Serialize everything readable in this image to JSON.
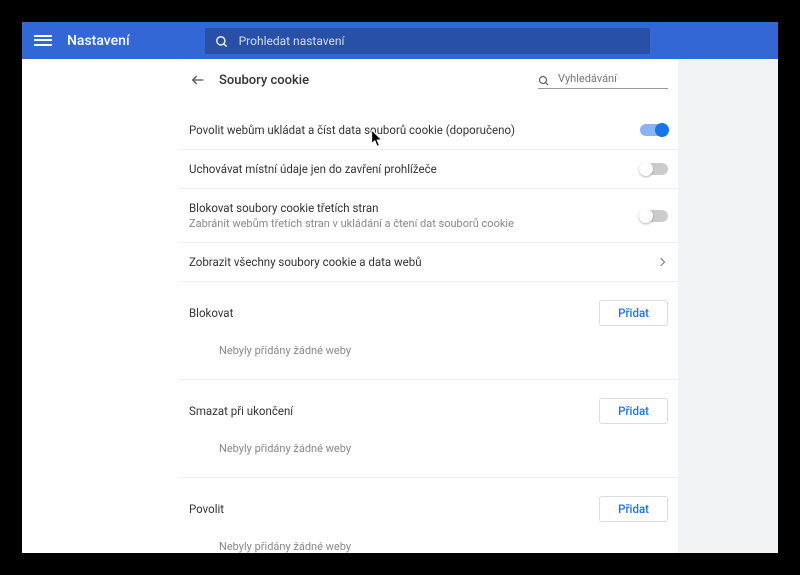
{
  "header": {
    "title": "Nastavení",
    "search_placeholder": "Prohledat nastavení"
  },
  "page": {
    "title": "Soubory cookie",
    "search_placeholder": "Vyhledávání"
  },
  "settings": {
    "allow_cookies": {
      "label": "Povolit webům ukládat a číst data souborů cookie (doporučeno)",
      "enabled": true
    },
    "keep_until_close": {
      "label": "Uchovávat místní údaje jen do zavření prohlížeče",
      "enabled": false
    },
    "block_third_party": {
      "label": "Blokovat soubory cookie třetích stran",
      "sub": "Zabránit webům třetích stran v ukládání a čtení dat souborů cookie",
      "enabled": false
    },
    "show_all": {
      "label": "Zobrazit všechny soubory cookie a data webů"
    }
  },
  "sections": {
    "block": {
      "title": "Blokovat",
      "add_label": "Přidat",
      "empty_text": "Nebyly přidány žádné weby"
    },
    "clear_on_exit": {
      "title": "Smazat při ukončení",
      "add_label": "Přidat",
      "empty_text": "Nebyly přidány žádné weby"
    },
    "allow": {
      "title": "Povolit",
      "add_label": "Přidat",
      "empty_text": "Nebyly přidány žádné weby"
    }
  }
}
